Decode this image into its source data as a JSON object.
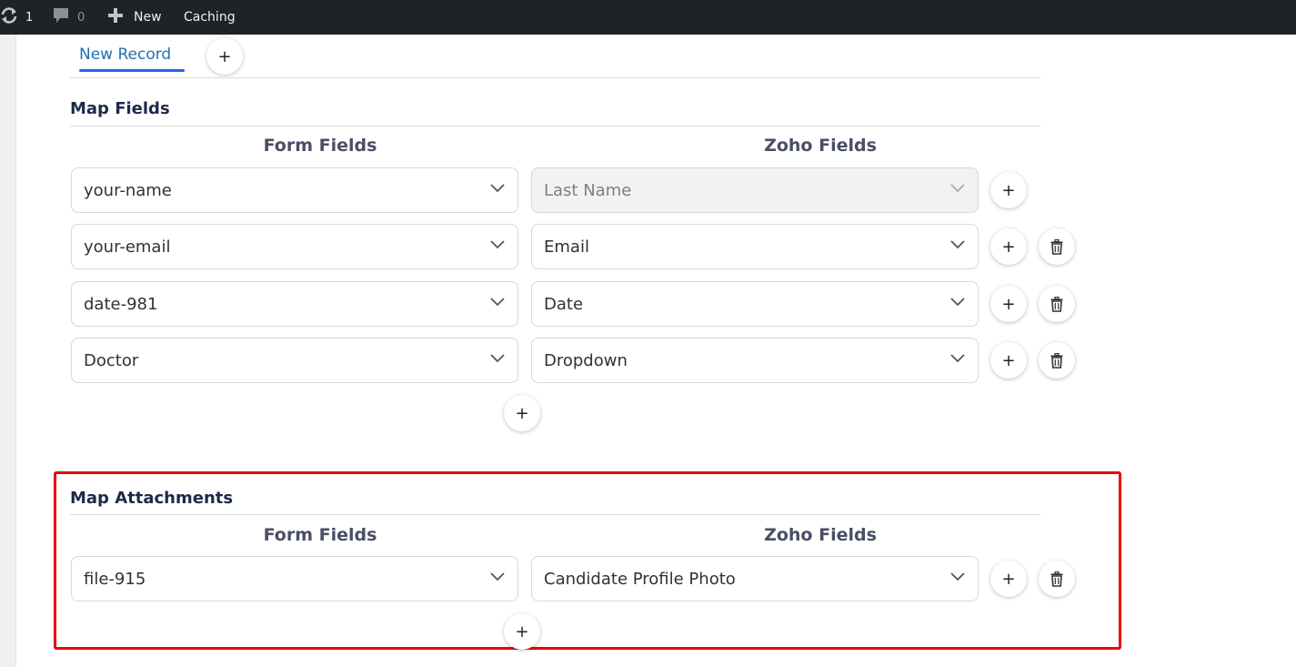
{
  "adminbar": {
    "updates_count": "1",
    "comments_count": "0",
    "new_label": "New",
    "caching_label": "Caching"
  },
  "tabs": {
    "active_label": "New Record",
    "add_label": "+"
  },
  "map_fields": {
    "title": "Map Fields",
    "form_header": "Form Fields",
    "zoho_header": "Zoho Fields",
    "rows": [
      {
        "form": "your-name",
        "zoho": "Last Name"
      },
      {
        "form": "your-email",
        "zoho": "Email"
      },
      {
        "form": "date-981",
        "zoho": "Date"
      },
      {
        "form": "Doctor",
        "zoho": "Dropdown"
      }
    ],
    "plus": "+"
  },
  "map_attachments": {
    "title": "Map Attachments",
    "form_header": "Form Fields",
    "zoho_header": "Zoho Fields",
    "rows": [
      {
        "form": "file-915",
        "zoho": "Candidate Profile Photo"
      }
    ],
    "plus": "+"
  },
  "colors": {
    "accent": "#2563eb",
    "highlight": "#ee0000",
    "adminbar": "#1d2327"
  }
}
